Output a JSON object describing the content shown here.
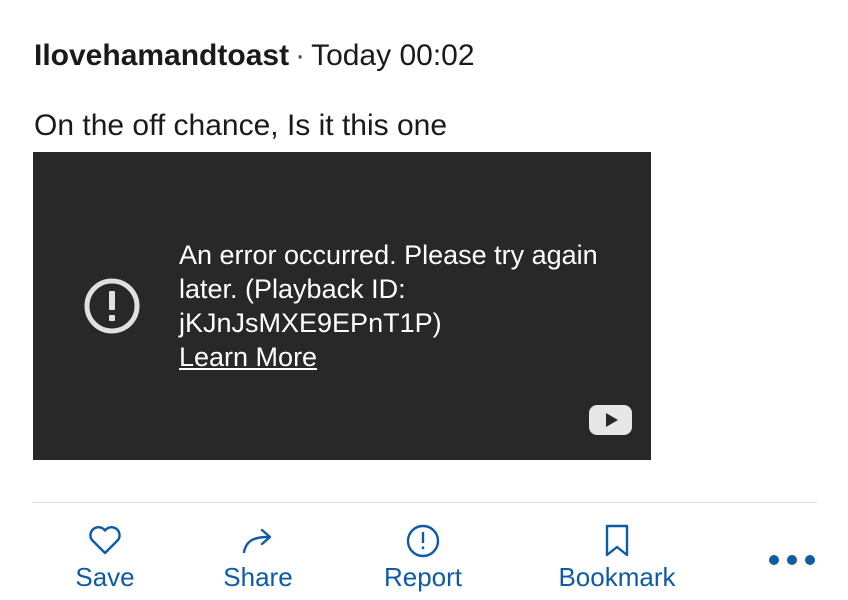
{
  "post": {
    "author": "Ilovehamandtoast",
    "separator": "·",
    "timestamp": "Today 00:02",
    "body": "On the off chance, Is it this one"
  },
  "video": {
    "error_message": "An error occurred. Please try again later. (Playback ID: jKJnJsMXE9EPnT1P)",
    "learn_more_label": "Learn More",
    "error_icon": "error-circle-icon",
    "logo_icon": "youtube-logo-icon"
  },
  "actions": {
    "save": {
      "label": "Save",
      "icon": "heart-icon"
    },
    "share": {
      "label": "Share",
      "icon": "share-arrow-icon"
    },
    "report": {
      "label": "Report",
      "icon": "exclamation-circle-icon"
    },
    "bookmark": {
      "label": "Bookmark",
      "icon": "bookmark-icon"
    },
    "more": {
      "icon": "more-dots-icon"
    }
  },
  "colors": {
    "action_blue": "#0d5aa7",
    "video_bg": "#282828",
    "text": "#1a1a1b"
  }
}
